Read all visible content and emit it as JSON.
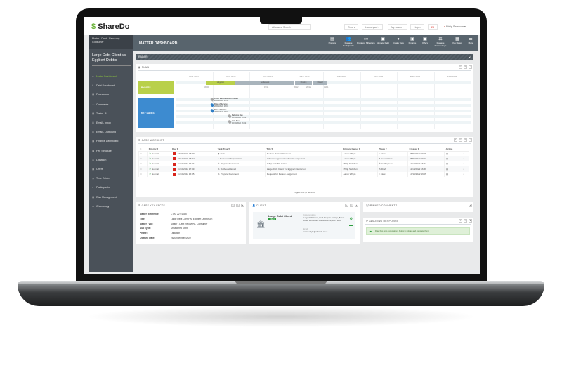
{
  "app": {
    "logo": "ShareDo",
    "search_scope": "All cases",
    "search_placeholder": "Search"
  },
  "topnav": {
    "items": [
      "Time ▾",
      "Launchpad ▾",
      "My cases ▾",
      "Help ▾"
    ],
    "notifications": "23",
    "user": "Philip Swinburn ▾"
  },
  "sidebar": {
    "breadcrumb": "Matter - Debt - Recovery - Consumer",
    "title": "Large Debt Client vs. Eggbert Debtor",
    "items": [
      {
        "label": "Matter Dashboard",
        "icon": "link-icon",
        "active": true
      },
      {
        "label": "Debt Dashboard",
        "icon": "info-icon"
      },
      {
        "label": "Documents",
        "icon": "document-icon"
      },
      {
        "label": "Comments",
        "icon": "comment-icon"
      },
      {
        "label": "Tasks - All",
        "icon": "tasks-icon"
      },
      {
        "label": "Email - Inbox",
        "icon": "mail-icon"
      },
      {
        "label": "Email - Outbound",
        "icon": "mail-icon"
      },
      {
        "label": "Finance Dashboard",
        "icon": "money-icon"
      },
      {
        "label": "Fee Structure",
        "icon": "money-icon"
      },
      {
        "label": "Litigation",
        "icon": "gavel-icon"
      },
      {
        "label": "Offers",
        "icon": "money-icon"
      },
      {
        "label": "Time Entries",
        "icon": "clock-icon"
      },
      {
        "label": "Participants",
        "icon": "users-icon"
      },
      {
        "label": "Risk Management",
        "icon": "risk-icon"
      },
      {
        "label": "Chronology",
        "icon": "chronology-icon"
      }
    ]
  },
  "header": {
    "title": "MATTER DASHBOARD",
    "actions": [
      {
        "label": "Prepare",
        "icon": "▤"
      },
      {
        "label": "Manage Participants",
        "icon": "👥"
      },
      {
        "label": "Progress Milestone",
        "icon": "⏭"
      },
      {
        "label": "Manage Debt",
        "icon": "▣"
      },
      {
        "label": "Create Task",
        "icon": "●"
      },
      {
        "label": "Finance",
        "icon": "▣"
      },
      {
        "label": "Offers",
        "icon": "▣"
      },
      {
        "label": "Manage Proceedings",
        "icon": "⚖"
      },
      {
        "label": "Key dates",
        "icon": "▦"
      },
      {
        "label": "More",
        "icon": "☰"
      }
    ]
  },
  "radar": {
    "title": "RADAR"
  },
  "plan": {
    "title": "PLAN",
    "months": [
      "SEP 2022",
      "OCT 2022",
      "NOV 2022",
      "DEC 2022",
      "JAN 2023",
      "FEB 2023",
      "MAR 2023",
      "APR 2023"
    ],
    "phases_label": "PHASES",
    "key_dates_label": "KEY DATES",
    "phases": [
      "Litigation",
      "Settlement",
      "Closing",
      "Closed"
    ],
    "phase_dates": [
      "30/09",
      "15/11",
      "30/12",
      "20/12",
      "31/01"
    ],
    "key_dates": [
      {
        "title": "Letter Before Action Issued",
        "date": "28/09/2022 17:42"
      },
      {
        "title": "Date of Service",
        "date": "28/09/2022 16:02"
      },
      {
        "title": "Date of Notice",
        "date": "28/09/2022 16:02"
      },
      {
        "title": "Defence Due",
        "date": "10/10/2022 16:02"
      },
      {
        "title": "AoS Due",
        "date": "10/10/2022 16:02"
      }
    ]
  },
  "worklist": {
    "title": "CASE WORKLIST",
    "columns": [
      "Priority ▾",
      "Due ▾",
      "Task Type ▾",
      "Title ▾",
      "Primary Owner ▾",
      "Phase ▾",
      "Created ▾",
      "Action"
    ],
    "rows": [
      [
        "Normal",
        "27/09/2022 16:09",
        "Task",
        "Review Posted Payment",
        "Aaron Whyte",
        "New",
        "26/09/2022 16:09"
      ],
      [
        "Normal",
        "10/10/2022 16:02",
        "Document Expectation",
        "Acknowledgement of Service Expected",
        "Aaron Whyte",
        "Expectation",
        "26/09/2022 16:02"
      ],
      [
        "Normal",
        "11/10/2022 16:24",
        "Prepare Document",
        "7 Top and Tail Letter",
        "Philip Swinburn",
        "In Progress",
        "11/10/2022 16:24"
      ],
      [
        "Normal",
        "11/10/2022 17:59",
        "Outbound Email",
        "Large Debt Client vs. Eggbert Debtorson",
        "Philip Swinburn",
        "Draft",
        "11/10/2022 16:59"
      ],
      [
        "Normal",
        "11/10/2022 16:05",
        "Prepare Document",
        "Request for Default Judgement",
        "Aaron Whyte",
        "New",
        "10/10/2022 16:05"
      ]
    ],
    "footer": "Page 1 of 1 (5 records)"
  },
  "key_facts": {
    "title": "CASE KEY FACTS",
    "rows": [
      [
        "Matter Reference:",
        "C DC 22 01085"
      ],
      [
        "Title:",
        "Large Debt Client vs. Eggbert Debtorson"
      ],
      [
        "Matter Type:",
        "Matter - Debt Recovery - Consumer"
      ],
      [
        "Sub Type:",
        "Unsecured Debt"
      ],
      [
        "Phase:",
        "Litigation"
      ],
      [
        "Opened Date:",
        "26/September/2022"
      ]
    ]
  },
  "client": {
    "title": "CLIENT",
    "name": "Large Debt Client",
    "badge": "Client",
    "address_label": "Correspondence",
    "address": "Large Debt Client, Loch Keepers Cottage, Beach Road, Worcester, Worcestershire, WR5 3DA",
    "email_label": "Email",
    "email": "aaron.whyte@sharedo.co.uk"
  },
  "pinned": {
    "title": "PINNED COMMENTS"
  },
  "awaiting": {
    "title": "AWAITING RESPONSE",
    "message": "Drag files onto expectations below to upload and complete them."
  },
  "colors": {
    "accent": "#8cc63f",
    "sidebar": "#4a5159",
    "header": "#58646d",
    "phase": "#b9d04a",
    "keydates": "#3d8bd0",
    "due": "#d9251c"
  }
}
